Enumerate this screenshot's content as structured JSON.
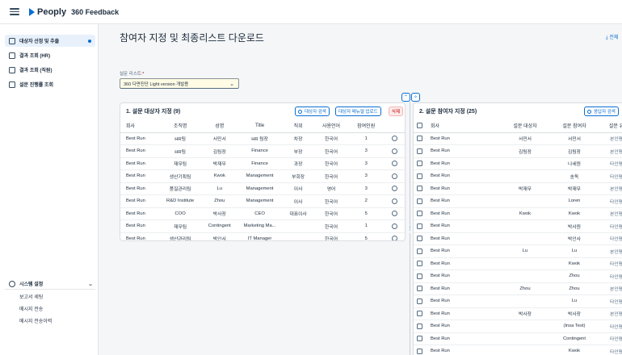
{
  "header": {
    "brand": "Peoply",
    "app_title": "360 Feedback"
  },
  "sidebar": {
    "items": [
      {
        "label": "대상자 선정 및 추출",
        "active": true
      },
      {
        "label": "결과 조회 (HR)"
      },
      {
        "label": "결과 조회 (직원)"
      },
      {
        "label": "설문 진행률 조회"
      }
    ],
    "system": {
      "label": "시스템 설정",
      "subitems": [
        "보고서 세팅",
        "메시지 전송",
        "메시지 전송이력"
      ]
    }
  },
  "main": {
    "title": "참여자 지정 및 최종리스트 다운로드",
    "download_label": "전체",
    "survey_list_label": "설문 리스트:",
    "survey_required": "*",
    "survey_selected": "360 다면진단 Light version 개발용"
  },
  "target_panel": {
    "title": "1. 설문 대상자 지정 (9)",
    "buttons": {
      "search": "대상자 검색",
      "upload": "대상자 매뉴얼 업로드",
      "delete": "삭제"
    },
    "columns": [
      "회사",
      "조직명",
      "성명",
      "Title",
      "직위",
      "사용언어",
      "참여인원",
      ""
    ],
    "rows": [
      [
        "Best Run",
        "HR팀",
        "서민서",
        "HR 팀장",
        "차장",
        "한국어",
        "1"
      ],
      [
        "Best Run",
        "HR팀",
        "김팀장",
        "Finance",
        "부장",
        "한국어",
        "3"
      ],
      [
        "Best Run",
        "재무팀",
        "박재무",
        "Finance",
        "과장",
        "한국어",
        "3"
      ],
      [
        "Best Run",
        "생산기획팀",
        "Kwok",
        "Management",
        "부회장",
        "한국어",
        "3"
      ],
      [
        "Best Run",
        "품질관리팀",
        "Lu",
        "Management",
        "이사",
        "영어",
        "3"
      ],
      [
        "Best Run",
        "R&D Institute",
        "Zhou",
        "Management",
        "이사",
        "한국어",
        "2"
      ],
      [
        "Best Run",
        "COO",
        "박사장",
        "CEO",
        "대표이사",
        "한국어",
        "5"
      ],
      [
        "Best Run",
        "재무팀",
        "Contingent",
        "Marketing Ma...",
        "",
        "한국어",
        "1"
      ],
      [
        "Best Run",
        "생산관리팀",
        "박인사",
        "IT Manager",
        "",
        "한국어",
        "5"
      ]
    ]
  },
  "participant_panel": {
    "title": "2. 설문 참여자 지정 (25)",
    "buttons": {
      "search": "응답자 검색"
    },
    "columns": [
      "",
      "회사",
      "설문 대상자",
      "설문 참여자",
      "설문 유"
    ],
    "rows": [
      [
        "Best Run",
        "서민서",
        "서민서",
        "본인평"
      ],
      [
        "Best Run",
        "김팀장",
        "김팀장",
        "본인평"
      ],
      [
        "Best Run",
        "",
        "나세원",
        "타인평"
      ],
      [
        "Best Run",
        "",
        "송독",
        "타인평"
      ],
      [
        "Best Run",
        "박재무",
        "박재무",
        "본인평"
      ],
      [
        "Best Run",
        "",
        "Loren",
        "타인평"
      ],
      [
        "Best Run",
        "Kwok",
        "Kwok",
        "본인평"
      ],
      [
        "Best Run",
        "",
        "박사원",
        "타인평"
      ],
      [
        "Best Run",
        "",
        "박인사",
        "타인평"
      ],
      [
        "Best Run",
        "Lu",
        "Lu",
        "본인평"
      ],
      [
        "Best Run",
        "",
        "Kwok",
        "타인평"
      ],
      [
        "Best Run",
        "",
        "Zhou",
        "타인평"
      ],
      [
        "Best Run",
        "Zhou",
        "Zhou",
        "본인평"
      ],
      [
        "Best Run",
        "",
        "Lu",
        "타인평"
      ],
      [
        "Best Run",
        "박사장",
        "박사장",
        "본인평"
      ],
      [
        "Best Run",
        "",
        "(Insa Test)",
        "타인평"
      ],
      [
        "Best Run",
        "",
        "Contingent",
        "타인평"
      ],
      [
        "Best Run",
        "",
        "Kwok",
        "타인평"
      ]
    ]
  }
}
